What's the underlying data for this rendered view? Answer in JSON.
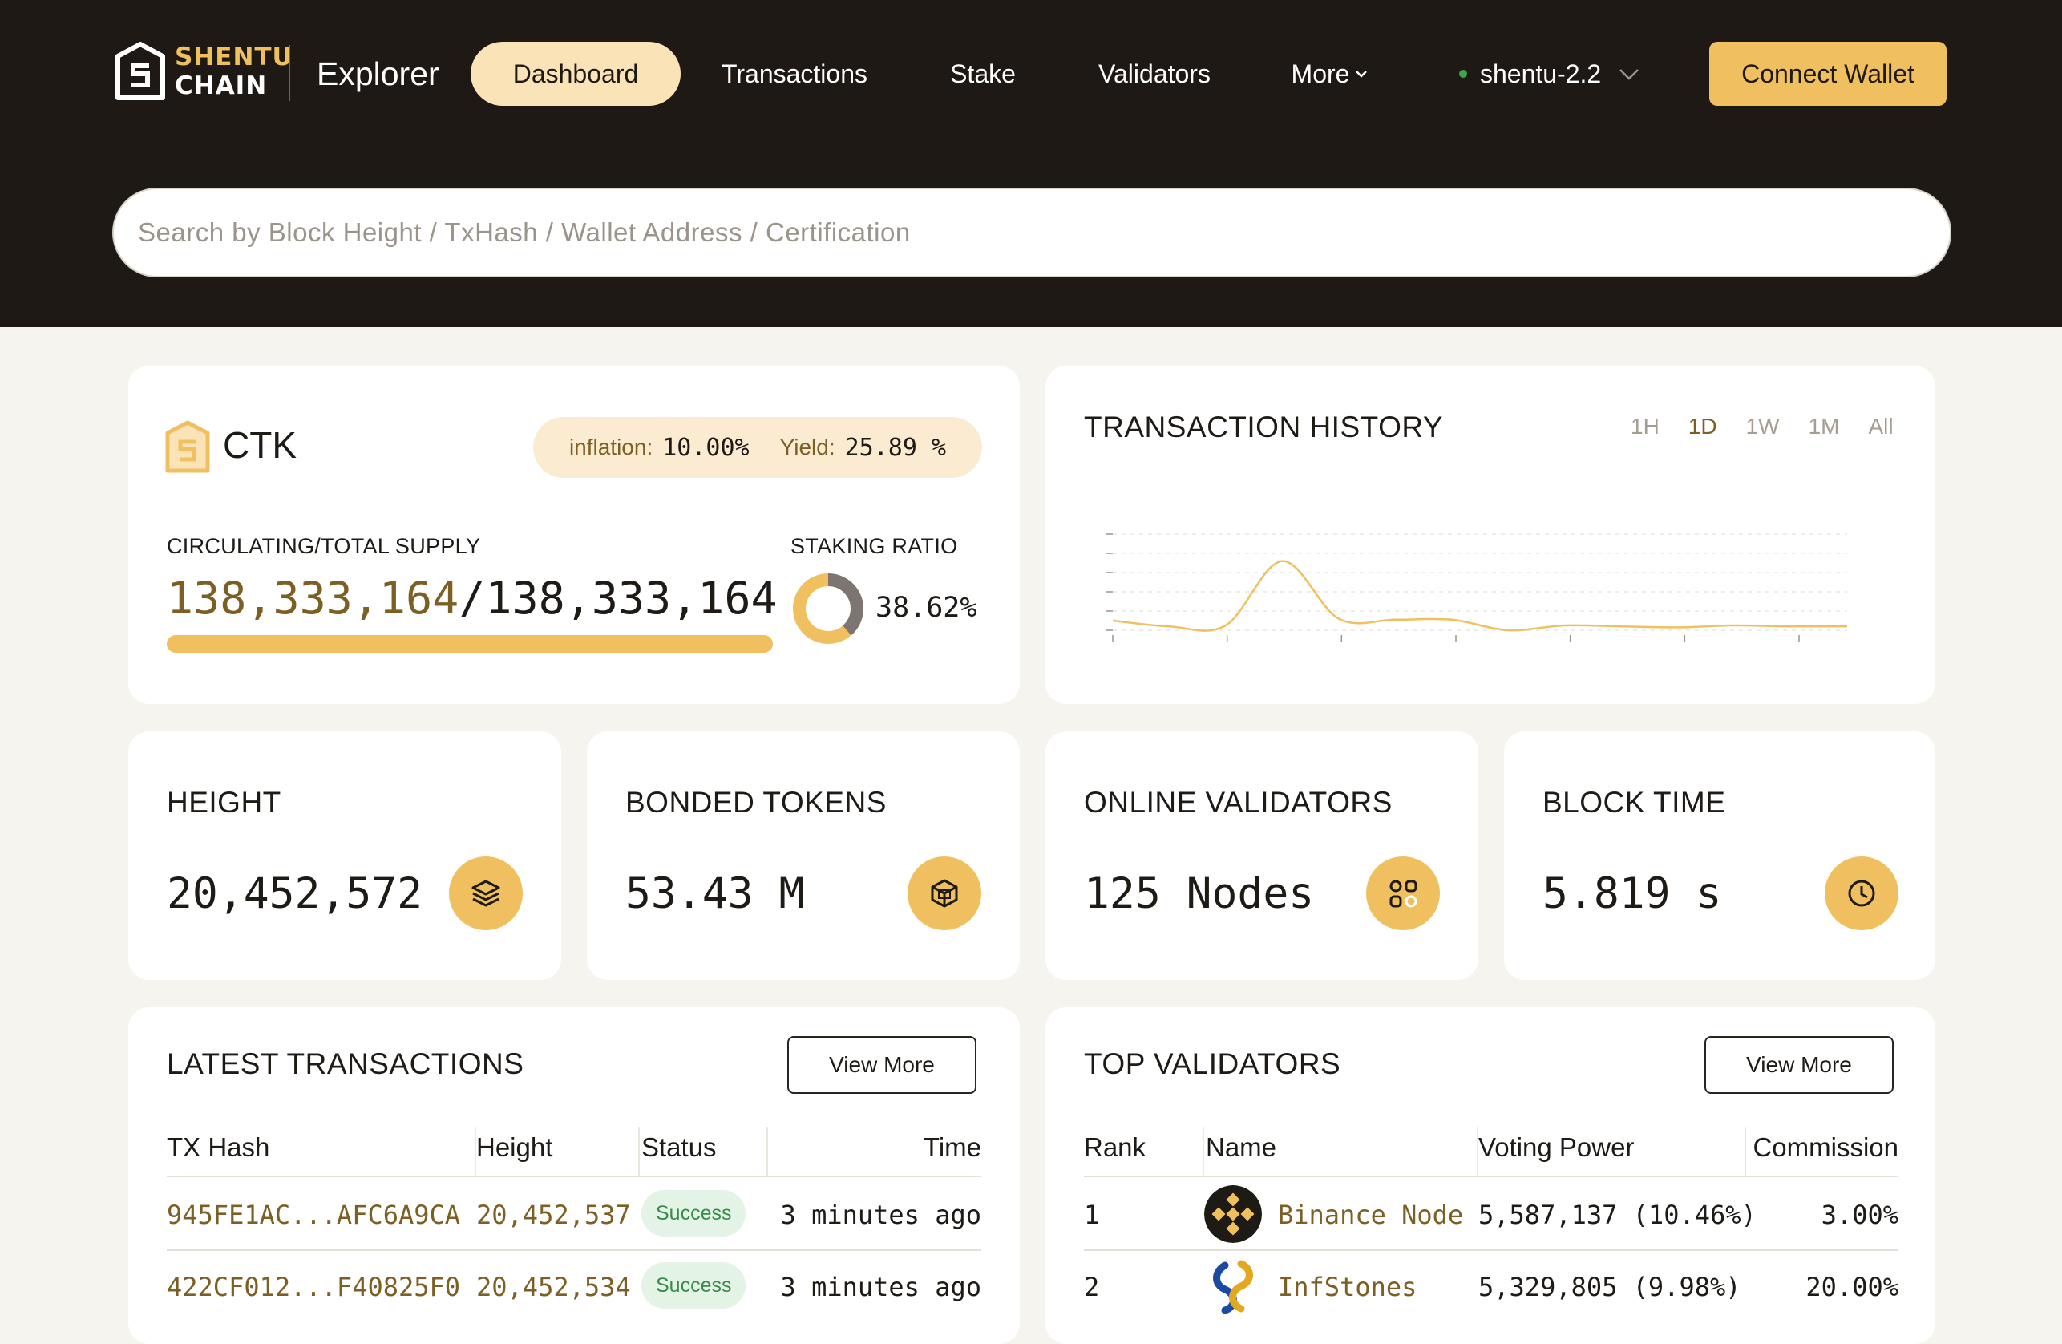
{
  "header": {
    "logo_line1": "SHENTU",
    "logo_line2": "CHAIN",
    "explorer_label": "Explorer",
    "nav": [
      {
        "label": "Dashboard",
        "active": true
      },
      {
        "label": "Transactions",
        "active": false
      },
      {
        "label": "Stake",
        "active": false
      },
      {
        "label": "Validators",
        "active": false
      },
      {
        "label": "More",
        "active": false
      }
    ],
    "network": "shentu-2.2",
    "connect_label": "Connect Wallet",
    "search_placeholder": "Search by Block Height / TxHash / Wallet Address / Certification"
  },
  "token": {
    "name": "CTK",
    "inflation_label": "inflation:",
    "inflation_value": "10.00%",
    "yield_label": "Yield:",
    "yield_value": "25.89 %",
    "supply_label": "CIRCULATING/TOTAL SUPPLY",
    "circulating": "138,333,164",
    "total": "/138,333,164",
    "supply_fraction": 1.0,
    "staking_label": "STAKING RATIO",
    "staking_ratio_text": "38.62%",
    "staking_ratio": 0.3862
  },
  "history": {
    "title": "TRANSACTION HISTORY",
    "ranges": [
      "1H",
      "1D",
      "1W",
      "1M",
      "All"
    ],
    "selected_range": "1D"
  },
  "chart_data": {
    "type": "line",
    "title": "TRANSACTION HISTORY",
    "xlabel": "",
    "ylabel": "",
    "grid": true,
    "x": [
      0,
      1,
      2,
      3,
      4,
      5,
      6,
      7,
      8,
      9,
      10,
      11,
      12,
      13
    ],
    "series": [
      {
        "values": [
          10,
          4,
          5,
          72,
          12,
          11,
          11,
          0,
          5,
          4,
          3,
          5,
          4,
          4
        ]
      }
    ],
    "ylim": [
      0,
      100
    ]
  },
  "stats": {
    "height_label": "HEIGHT",
    "height_value": "20,452,572",
    "bonded_label": "BONDED TOKENS",
    "bonded_value": "53.43 M",
    "validators_label": "ONLINE VALIDATORS",
    "validators_value": "125 Nodes",
    "blocktime_label": "BLOCK TIME",
    "blocktime_value": "5.819 s"
  },
  "latest_tx": {
    "title": "LATEST TRANSACTIONS",
    "view_more": "View More",
    "headers": [
      "TX Hash",
      "Height",
      "Status",
      "Time"
    ],
    "rows": [
      {
        "hash": "945FE1AC...AFC6A9CA",
        "height": "20,452,537",
        "status": "Success",
        "time": "3 minutes ago"
      },
      {
        "hash": "422CF012...F40825F0",
        "height": "20,452,534",
        "status": "Success",
        "time": "3 minutes ago"
      }
    ]
  },
  "top_validators": {
    "title": "TOP VALIDATORS",
    "view_more": "View More",
    "headers": [
      "Rank",
      "Name",
      "Voting Power",
      "Commission"
    ],
    "rows": [
      {
        "rank": "1",
        "name": "Binance Node",
        "power": "5,587,137 (10.46%)",
        "commission": "3.00%",
        "icon": "binance-icon"
      },
      {
        "rank": "2",
        "name": "InfStones",
        "power": "5,329,805 (9.98%)",
        "commission": "20.00%",
        "icon": "infstones-icon"
      }
    ]
  },
  "colors": {
    "header_bg": "#1e1914",
    "accent": "#f0c060",
    "accent_soft": "#fbe3b8",
    "link": "#7c5f25",
    "success_bg": "#e3f3e5",
    "success_text": "#3b8c4a"
  }
}
